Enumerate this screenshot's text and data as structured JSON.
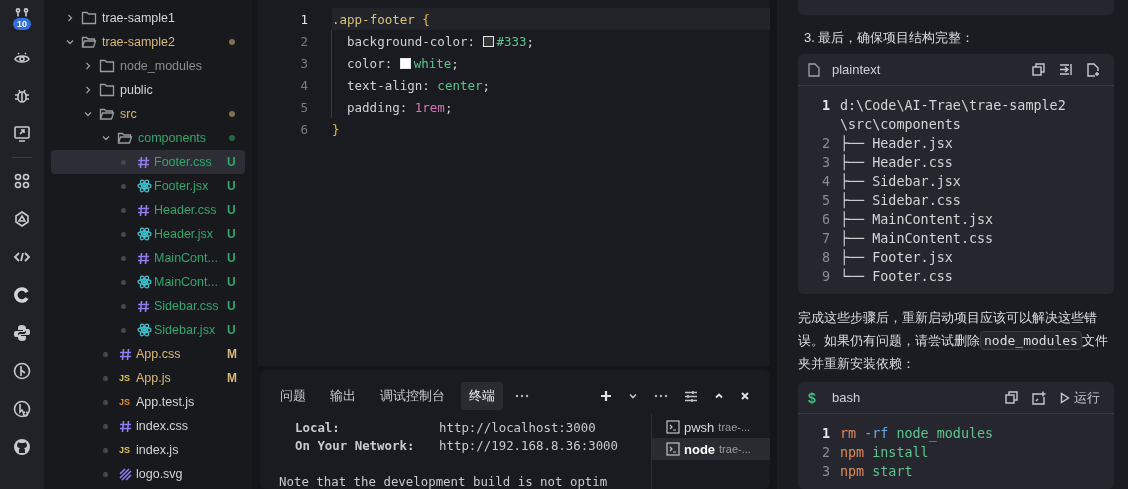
{
  "activity_bar": {
    "items": [
      {
        "kind": "git",
        "badge": "10"
      },
      {
        "kind": "eye"
      },
      {
        "kind": "bug"
      },
      {
        "kind": "monitor"
      },
      {
        "kind": "divider"
      },
      {
        "kind": "grid"
      },
      {
        "kind": "pinwheel"
      },
      {
        "kind": "code"
      },
      {
        "kind": "ring"
      },
      {
        "kind": "snake"
      },
      {
        "kind": "deploy"
      },
      {
        "kind": "pointer"
      },
      {
        "kind": "cat"
      }
    ]
  },
  "file_tree": {
    "items": [
      {
        "label": "trae-sample1",
        "kind": "folder",
        "expanded": false,
        "color": "#d4d4d6",
        "changed": false
      },
      {
        "label": "trae-sample2",
        "kind": "folder",
        "expanded": true,
        "color": "#d9b978",
        "changed": true,
        "children": [
          {
            "label": "node_modules",
            "kind": "folder",
            "expanded": false,
            "color": "#8a8c93",
            "changed": false
          },
          {
            "label": "public",
            "kind": "folder",
            "expanded": false,
            "color": "#d4d4d6",
            "changed": false
          },
          {
            "label": "src",
            "kind": "folder",
            "expanded": true,
            "color": "#d9b978",
            "changed": true,
            "children": [
              {
                "label": "components",
                "kind": "folder",
                "expanded": true,
                "color": "#2ea86c",
                "changed": true,
                "children": [
                  {
                    "label": "Footer.css",
                    "kind": "css",
                    "color": "#2ea86c",
                    "status": "U",
                    "selected": true
                  },
                  {
                    "label": "Footer.jsx",
                    "kind": "react",
                    "color": "#2ea86c",
                    "status": "U",
                    "selected": false
                  },
                  {
                    "label": "Header.css",
                    "kind": "css",
                    "color": "#2ea86c",
                    "status": "U",
                    "selected": false
                  },
                  {
                    "label": "Header.jsx",
                    "kind": "react",
                    "color": "#2ea86c",
                    "status": "U",
                    "selected": false
                  },
                  {
                    "label": "MainCont...",
                    "kind": "css",
                    "color": "#2ea86c",
                    "status": "U",
                    "selected": false
                  },
                  {
                    "label": "MainCont...",
                    "kind": "react",
                    "color": "#2ea86c",
                    "status": "U",
                    "selected": false
                  },
                  {
                    "label": "Sidebar.css",
                    "kind": "css",
                    "color": "#2ea86c",
                    "status": "U",
                    "selected": false
                  },
                  {
                    "label": "Sidebar.jsx",
                    "kind": "react",
                    "color": "#2ea86c",
                    "status": "U",
                    "selected": false
                  }
                ]
              },
              {
                "label": "App.css",
                "kind": "css",
                "color": "#d9b978",
                "status": "M",
                "selected": false
              },
              {
                "label": "App.js",
                "kind": "js",
                "badge": "JS",
                "color": "#d9b978",
                "status": "M",
                "selected": false
              },
              {
                "label": "App.test.js",
                "kind": "test",
                "badge": "JS",
                "color": "#d4d4d6",
                "selected": false
              },
              {
                "label": "index.css",
                "kind": "css",
                "color": "#d4d4d6",
                "selected": false
              },
              {
                "label": "index.js",
                "kind": "js",
                "badge": "JS",
                "color": "#d4d4d6",
                "selected": false
              },
              {
                "label": "logo.svg",
                "kind": "svg",
                "color": "#d4d4d6",
                "selected": false
              }
            ]
          }
        ]
      }
    ]
  },
  "editor": {
    "lines": [
      {
        "number": "1",
        "active": true,
        "tokens": [
          {
            "kind": "selector",
            "t": ".app-footer"
          },
          {
            "kind": "brace",
            "t": "{"
          }
        ]
      },
      {
        "number": "2",
        "active": false,
        "tokens": [
          {
            "kind": "prop",
            "t": "background-color:"
          },
          {
            "kind": "swatch",
            "color": "#333333"
          },
          {
            "kind": "value",
            "t": "#333"
          },
          {
            "kind": "punct",
            "t": ";"
          }
        ]
      },
      {
        "number": "3",
        "active": false,
        "tokens": [
          {
            "kind": "prop",
            "t": "color:"
          },
          {
            "kind": "swatch",
            "color": "#ffffff"
          },
          {
            "kind": "value",
            "t": "white"
          },
          {
            "kind": "punct",
            "t": ";"
          }
        ]
      },
      {
        "number": "4",
        "active": false,
        "tokens": [
          {
            "kind": "prop",
            "t": "text-align:"
          },
          {
            "kind": "value",
            "t": "center"
          },
          {
            "kind": "punct",
            "t": ";"
          }
        ]
      },
      {
        "number": "5",
        "active": false,
        "tokens": [
          {
            "kind": "prop",
            "t": "padding:"
          },
          {
            "kind": "number",
            "t": "1rem"
          },
          {
            "kind": "punct",
            "t": ";"
          }
        ]
      },
      {
        "number": "6",
        "active": false,
        "tokens": [
          {
            "kind": "brace",
            "t": "}"
          }
        ]
      }
    ]
  },
  "panel": {
    "tabs": [
      {
        "label": "问题",
        "selected": false
      },
      {
        "label": "输出",
        "selected": false
      },
      {
        "label": "调试控制台",
        "selected": false
      },
      {
        "label": "终端",
        "selected": true
      }
    ],
    "terminal_lines": [
      {
        "kind": "pair",
        "key": "Local:",
        "value": "http://localhost:3000"
      },
      {
        "kind": "pair",
        "key": "On Your Network:",
        "value": "http://192.168.8.36:3000"
      },
      {
        "kind": "text",
        "text": "Note that the development build is not optim"
      }
    ],
    "sessions": [
      {
        "name": "pwsh",
        "detail": "trae-...",
        "selected": false
      },
      {
        "name": "node",
        "detail": "trae-...",
        "selected": true
      }
    ]
  },
  "chat": {
    "step": "3. 最后，确保项目结构完整：",
    "tree_block": {
      "language": "plaintext",
      "lines": [
        {
          "number": "1",
          "active": true,
          "text": "d:\\Code\\AI-Trae\\trae-sample2\\src\\components"
        },
        {
          "number": "2",
          "active": false,
          "text": "├── Header.jsx"
        },
        {
          "number": "3",
          "active": false,
          "text": "├── Header.css"
        },
        {
          "number": "4",
          "active": false,
          "text": "├── Sidebar.jsx"
        },
        {
          "number": "5",
          "active": false,
          "text": "├── Sidebar.css"
        },
        {
          "number": "6",
          "active": false,
          "text": "├── MainContent.jsx"
        },
        {
          "number": "7",
          "active": false,
          "text": "├── MainContent.css"
        },
        {
          "number": "8",
          "active": false,
          "text": "├── Footer.jsx"
        },
        {
          "number": "9",
          "active": false,
          "text": "└── Footer.css"
        }
      ]
    },
    "paragraph": [
      {
        "kind": "text",
        "t": "完成这些步骤后，重新启动项目应该可以解决这些错误。如果仍有问题，请尝试删除"
      },
      {
        "kind": "code",
        "t": "node_modules"
      },
      {
        "kind": "text",
        "t": "文件夹并重新安装依赖："
      }
    ],
    "bash_block": {
      "prompt": "$",
      "language": "bash",
      "run_label": "运行",
      "lines": [
        {
          "number": "1",
          "active": true,
          "tokens": [
            {
              "kind": "command",
              "t": "rm"
            },
            {
              "kind": "flag",
              "t": "-rf"
            },
            {
              "kind": "arg",
              "t": "node_modules"
            }
          ]
        },
        {
          "number": "2",
          "active": false,
          "tokens": [
            {
              "kind": "command",
              "t": "npm"
            },
            {
              "kind": "arg",
              "t": "install"
            }
          ]
        },
        {
          "number": "3",
          "active": false,
          "tokens": [
            {
              "kind": "command",
              "t": "npm"
            },
            {
              "kind": "arg",
              "t": "start"
            }
          ]
        }
      ]
    }
  }
}
